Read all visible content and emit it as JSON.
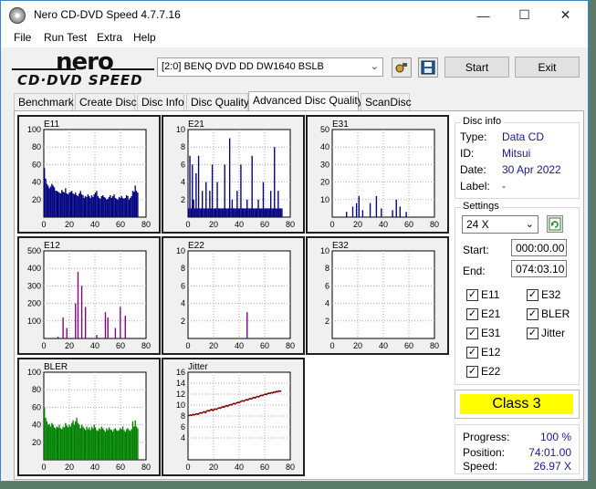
{
  "window": {
    "title": "Nero CD-DVD Speed 4.7.7.16"
  },
  "menu": [
    "File",
    "Run Test",
    "Extra",
    "Help"
  ],
  "logo": {
    "brand": "nero",
    "product": "CD·DVD SPEED"
  },
  "toolbar": {
    "drive": "[2:0]  BENQ DVD DD DW1640 BSLB",
    "start_label": "Start",
    "exit_label": "Exit"
  },
  "tabs": [
    "Benchmark",
    "Create Disc",
    "Disc Info",
    "Disc Quality",
    "Advanced Disc Quality",
    "ScanDisc"
  ],
  "active_tab": "Advanced Disc Quality",
  "disc_info": {
    "title": "Disc info",
    "type_label": "Type:",
    "type": "Data CD",
    "id_label": "ID:",
    "id": "Mitsui",
    "date_label": "Date:",
    "date": "30 Apr 2022",
    "label_label": "Label:",
    "label": "-"
  },
  "settings": {
    "title": "Settings",
    "speed": "24 X",
    "start_label": "Start:",
    "start": "000:00.00",
    "end_label": "End:",
    "end": "074:03.10",
    "checks": [
      {
        "label": "E11",
        "checked": true
      },
      {
        "label": "E32",
        "checked": true
      },
      {
        "label": "E21",
        "checked": true
      },
      {
        "label": "BLER",
        "checked": true
      },
      {
        "label": "E31",
        "checked": true
      },
      {
        "label": "Jitter",
        "checked": true
      },
      {
        "label": "E12",
        "checked": true
      },
      {
        "label": "E22",
        "checked": true
      }
    ]
  },
  "result": {
    "class": "Class 3"
  },
  "progress": {
    "progress_label": "Progress:",
    "progress": "100 %",
    "position_label": "Position:",
    "position": "74:01.00",
    "speed_label": "Speed:",
    "speed": "26.97 X"
  },
  "chart_data": [
    {
      "name": "E11",
      "type": "bar",
      "color": "#000080",
      "ylim": [
        0,
        100
      ],
      "yticks": [
        20,
        40,
        60,
        80,
        100
      ],
      "xticks": [
        0,
        20,
        40,
        60,
        80
      ],
      "xlim": [
        0,
        80
      ],
      "values": [
        56,
        44,
        38,
        36,
        33,
        35,
        38,
        36,
        34,
        30,
        30,
        29,
        28,
        27,
        31,
        29,
        28,
        33,
        27,
        26,
        28,
        29,
        30,
        27,
        26,
        28,
        25,
        24,
        27,
        30,
        26,
        25,
        22,
        24,
        23,
        26,
        24,
        22,
        25,
        23,
        26,
        28,
        30,
        24,
        22,
        21,
        24,
        25,
        23,
        22,
        20,
        21,
        23,
        25,
        22,
        24,
        26,
        22,
        21,
        20,
        23,
        22,
        24,
        22,
        21,
        22,
        25,
        24,
        20,
        22,
        24,
        30,
        29,
        36,
        30,
        28
      ]
    },
    {
      "name": "E21",
      "type": "bar",
      "color": "#000080",
      "ylim": [
        0,
        10
      ],
      "yticks": [
        2,
        4,
        6,
        8,
        10
      ],
      "xticks": [
        0,
        20,
        40,
        60,
        80
      ],
      "xlim": [
        0,
        80
      ],
      "values": [
        1,
        7,
        1,
        6,
        2,
        1,
        5,
        1,
        7,
        1,
        1,
        3,
        1,
        1,
        4,
        1,
        1,
        3,
        1,
        6,
        1,
        1,
        1,
        4,
        1,
        1,
        1,
        1,
        1,
        6,
        1,
        1,
        1,
        9,
        1,
        2,
        1,
        1,
        1,
        3,
        1,
        1,
        6,
        1,
        1,
        1,
        1,
        2,
        1,
        1,
        1,
        7,
        1,
        1,
        1,
        1,
        2,
        1,
        1,
        1,
        4,
        1,
        1,
        1,
        1,
        1,
        3,
        1,
        1,
        8,
        1,
        1,
        3,
        1,
        1,
        1
      ]
    },
    {
      "name": "E31",
      "type": "bar",
      "color": "#000080",
      "ylim": [
        0,
        50
      ],
      "yticks": [
        10,
        20,
        30,
        40,
        50
      ],
      "xticks": [
        0,
        20,
        40,
        60,
        80
      ],
      "xlim": [
        0,
        80
      ],
      "values": [
        0,
        0,
        0,
        0,
        0,
        0,
        0,
        0,
        0,
        0,
        0,
        3,
        0,
        0,
        0,
        0,
        6,
        0,
        0,
        8,
        0,
        12,
        0,
        0,
        4,
        0,
        0,
        0,
        0,
        0,
        8,
        0,
        0,
        0,
        0,
        12,
        0,
        0,
        0,
        5,
        0,
        0,
        0,
        0,
        0,
        0,
        0,
        0,
        4,
        0,
        0,
        10,
        0,
        0,
        6,
        0,
        0,
        0,
        0,
        3,
        0,
        0,
        0,
        0,
        0,
        0,
        0,
        0,
        0,
        0,
        0,
        0,
        0,
        0,
        0,
        0
      ]
    },
    {
      "name": "E12",
      "type": "bar",
      "color": "#800080",
      "ylim": [
        0,
        500
      ],
      "yticks": [
        100,
        200,
        300,
        400,
        500
      ],
      "xticks": [
        0,
        20,
        40,
        60,
        80
      ],
      "xlim": [
        0,
        80
      ],
      "values": [
        0,
        0,
        0,
        0,
        0,
        0,
        0,
        0,
        0,
        0,
        0,
        10,
        0,
        0,
        0,
        120,
        0,
        0,
        60,
        0,
        0,
        0,
        0,
        0,
        0,
        200,
        0,
        380,
        0,
        0,
        300,
        0,
        0,
        180,
        0,
        0,
        0,
        0,
        0,
        0,
        0,
        0,
        20,
        0,
        0,
        0,
        0,
        0,
        0,
        150,
        0,
        120,
        0,
        0,
        0,
        0,
        0,
        60,
        0,
        0,
        0,
        180,
        0,
        0,
        0,
        130,
        0,
        0,
        0,
        0,
        0,
        0,
        0,
        0,
        0,
        0
      ]
    },
    {
      "name": "E22",
      "type": "bar",
      "color": "#800080",
      "ylim": [
        0,
        10
      ],
      "yticks": [
        2,
        4,
        6,
        8,
        10
      ],
      "xticks": [
        0,
        20,
        40,
        60,
        80
      ],
      "xlim": [
        0,
        80
      ],
      "values": [
        0,
        0,
        0,
        0,
        0,
        0,
        0,
        0,
        0,
        0,
        0,
        0,
        0,
        0,
        0,
        0,
        0,
        0,
        0,
        0,
        0,
        0,
        0,
        0,
        0,
        0,
        0,
        0,
        0,
        0,
        0,
        0,
        0,
        0,
        0,
        0,
        0,
        0,
        0,
        0,
        0,
        0,
        0,
        0,
        0,
        0,
        0,
        3,
        0,
        0,
        0,
        0,
        0,
        0,
        0,
        0,
        0,
        0,
        0,
        0,
        0,
        0,
        0,
        0,
        0,
        0,
        0,
        0,
        0,
        0,
        0,
        0,
        0,
        0,
        0,
        0
      ]
    },
    {
      "name": "E32",
      "type": "bar",
      "color": "#800080",
      "ylim": [
        0,
        10
      ],
      "yticks": [
        2,
        4,
        6,
        8,
        10
      ],
      "xticks": [
        0,
        20,
        40,
        60,
        80
      ],
      "xlim": [
        0,
        80
      ],
      "values": []
    },
    {
      "name": "BLER",
      "type": "bar",
      "color": "#008000",
      "ylim": [
        0,
        100
      ],
      "yticks": [
        20,
        40,
        60,
        80,
        100
      ],
      "xticks": [
        0,
        20,
        40,
        60,
        80
      ],
      "xlim": [
        0,
        80
      ],
      "values": [
        60,
        48,
        44,
        40,
        41,
        38,
        42,
        40,
        37,
        36,
        38,
        37,
        40,
        36,
        35,
        38,
        37,
        42,
        39,
        37,
        40,
        38,
        42,
        45,
        40,
        44,
        48,
        42,
        40,
        36,
        40,
        38,
        36,
        34,
        38,
        35,
        37,
        34,
        38,
        36,
        40,
        37,
        34,
        33,
        36,
        35,
        38,
        36,
        34,
        32,
        36,
        34,
        37,
        35,
        34,
        32,
        35,
        36,
        34,
        33,
        34,
        36,
        35,
        38,
        34,
        32,
        35,
        36,
        34,
        33,
        35,
        44,
        38,
        45,
        38,
        36
      ]
    },
    {
      "name": "Jitter",
      "type": "line",
      "color": "#800000",
      "ylim": [
        0,
        16
      ],
      "yticks": [
        4,
        6,
        8,
        10,
        12,
        14,
        16
      ],
      "xticks": [
        0,
        20,
        40,
        60,
        80
      ],
      "xlim": [
        0,
        80
      ],
      "values": [
        8.0,
        8.1,
        8.2,
        8.1,
        8.3,
        8.2,
        8.3,
        8.4,
        8.3,
        8.5,
        8.6,
        8.5,
        8.7,
        8.8,
        8.6,
        8.9,
        9.0,
        8.9,
        9.1,
        9.2,
        9.0,
        9.2,
        9.3,
        9.2,
        9.4,
        9.5,
        9.4,
        9.6,
        9.7,
        9.6,
        9.8,
        9.9,
        9.8,
        10.0,
        10.1,
        10.0,
        10.2,
        10.3,
        10.2,
        10.4,
        10.5,
        10.4,
        10.6,
        10.7,
        10.8,
        10.7,
        10.9,
        11.0,
        10.9,
        11.1,
        11.2,
        11.1,
        11.3,
        11.4,
        11.3,
        11.5,
        11.6,
        11.5,
        11.7,
        11.8,
        11.7,
        11.9,
        12.0,
        11.9,
        12.1,
        12.2,
        12.1,
        12.3,
        12.2,
        12.4,
        12.3,
        12.5,
        12.4,
        12.6,
        12.5,
        12.6
      ]
    }
  ]
}
